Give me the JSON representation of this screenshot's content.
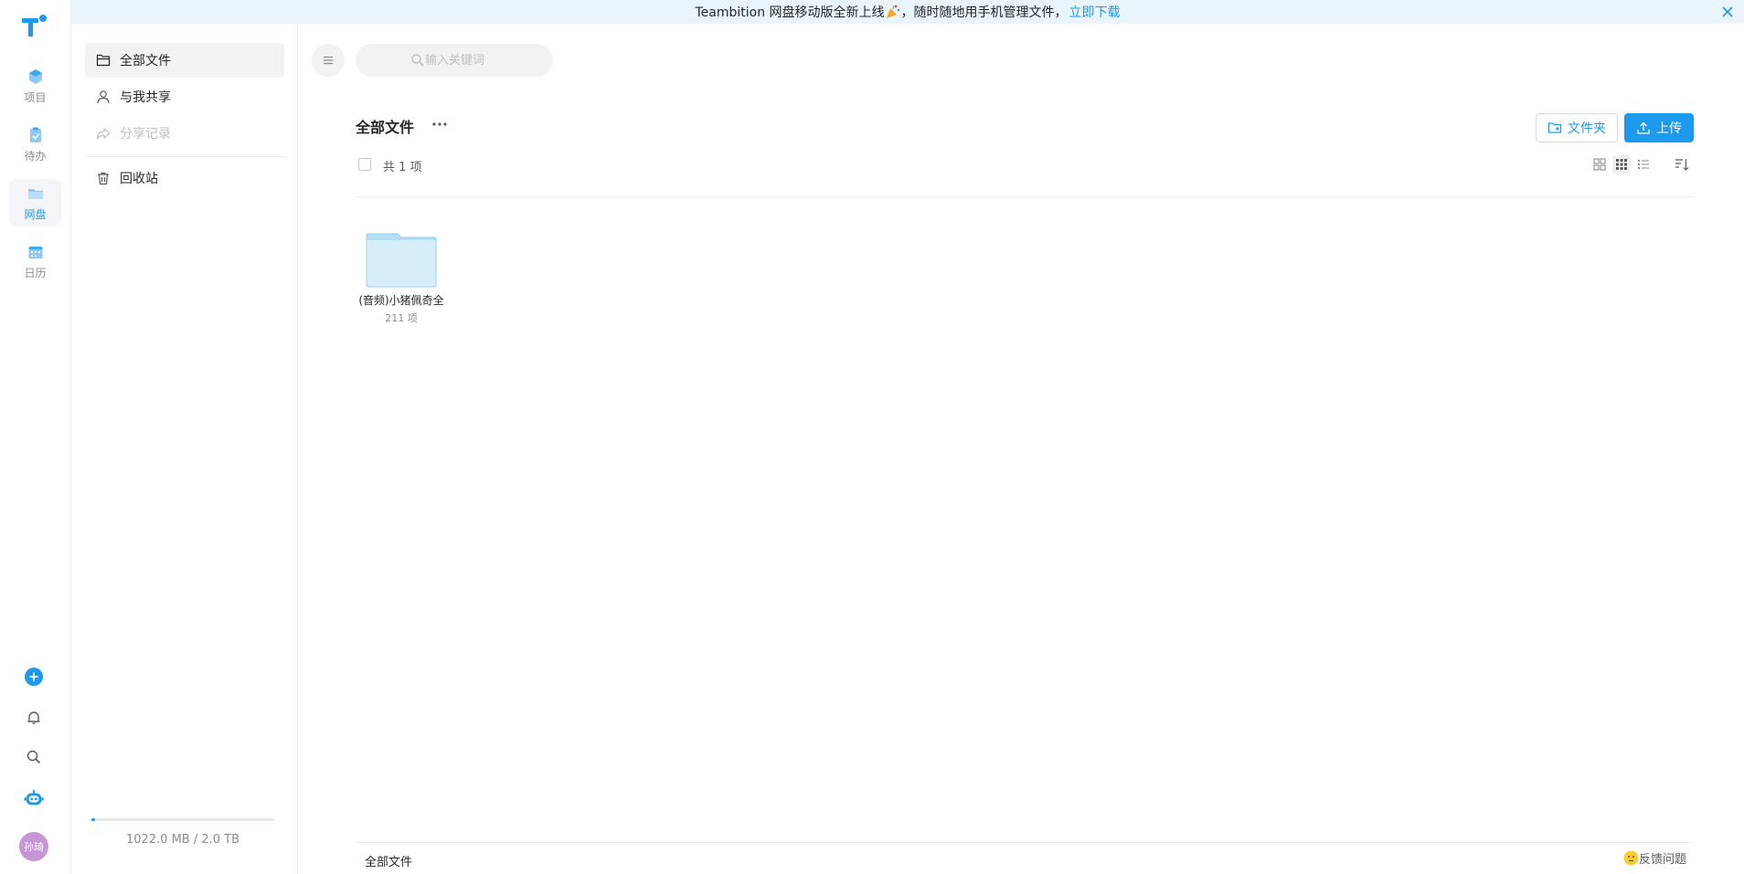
{
  "rail": {
    "items": [
      {
        "label": "项目",
        "icon": "project-cube-icon"
      },
      {
        "label": "待办",
        "icon": "todo-clipboard-icon"
      },
      {
        "label": "网盘",
        "icon": "drive-folder-icon",
        "active": true
      },
      {
        "label": "日历",
        "icon": "calendar-icon"
      }
    ],
    "avatar_text": "孙琦",
    "accent": "#1b9aee"
  },
  "banner": {
    "text_before": "Teambition 网盘移动版全新上线",
    "text_after": "，随时随地用手机管理文件，",
    "link": "立即下载"
  },
  "sidebar": {
    "items": [
      {
        "label": "全部文件",
        "icon": "folder-outline-icon",
        "active": true
      },
      {
        "label": "与我共享",
        "icon": "user-icon"
      },
      {
        "label": "分享记录",
        "icon": "share-icon",
        "disabled": true
      },
      {
        "label": "回收站",
        "icon": "trash-icon"
      }
    ],
    "storage": {
      "used_text": "1022.0 MB / 2.0 TB",
      "fraction": 0.0005
    }
  },
  "main": {
    "search_placeholder": "输入关键词",
    "title": "全部文件",
    "new_folder_label": "文件夹",
    "upload_label": "上传",
    "count_text": "共 1 项",
    "files": [
      {
        "name": "(音频)小猪佩奇全",
        "count": "211 项"
      }
    ],
    "footer_label": "全部文件",
    "feedback_label": "反馈问题"
  }
}
